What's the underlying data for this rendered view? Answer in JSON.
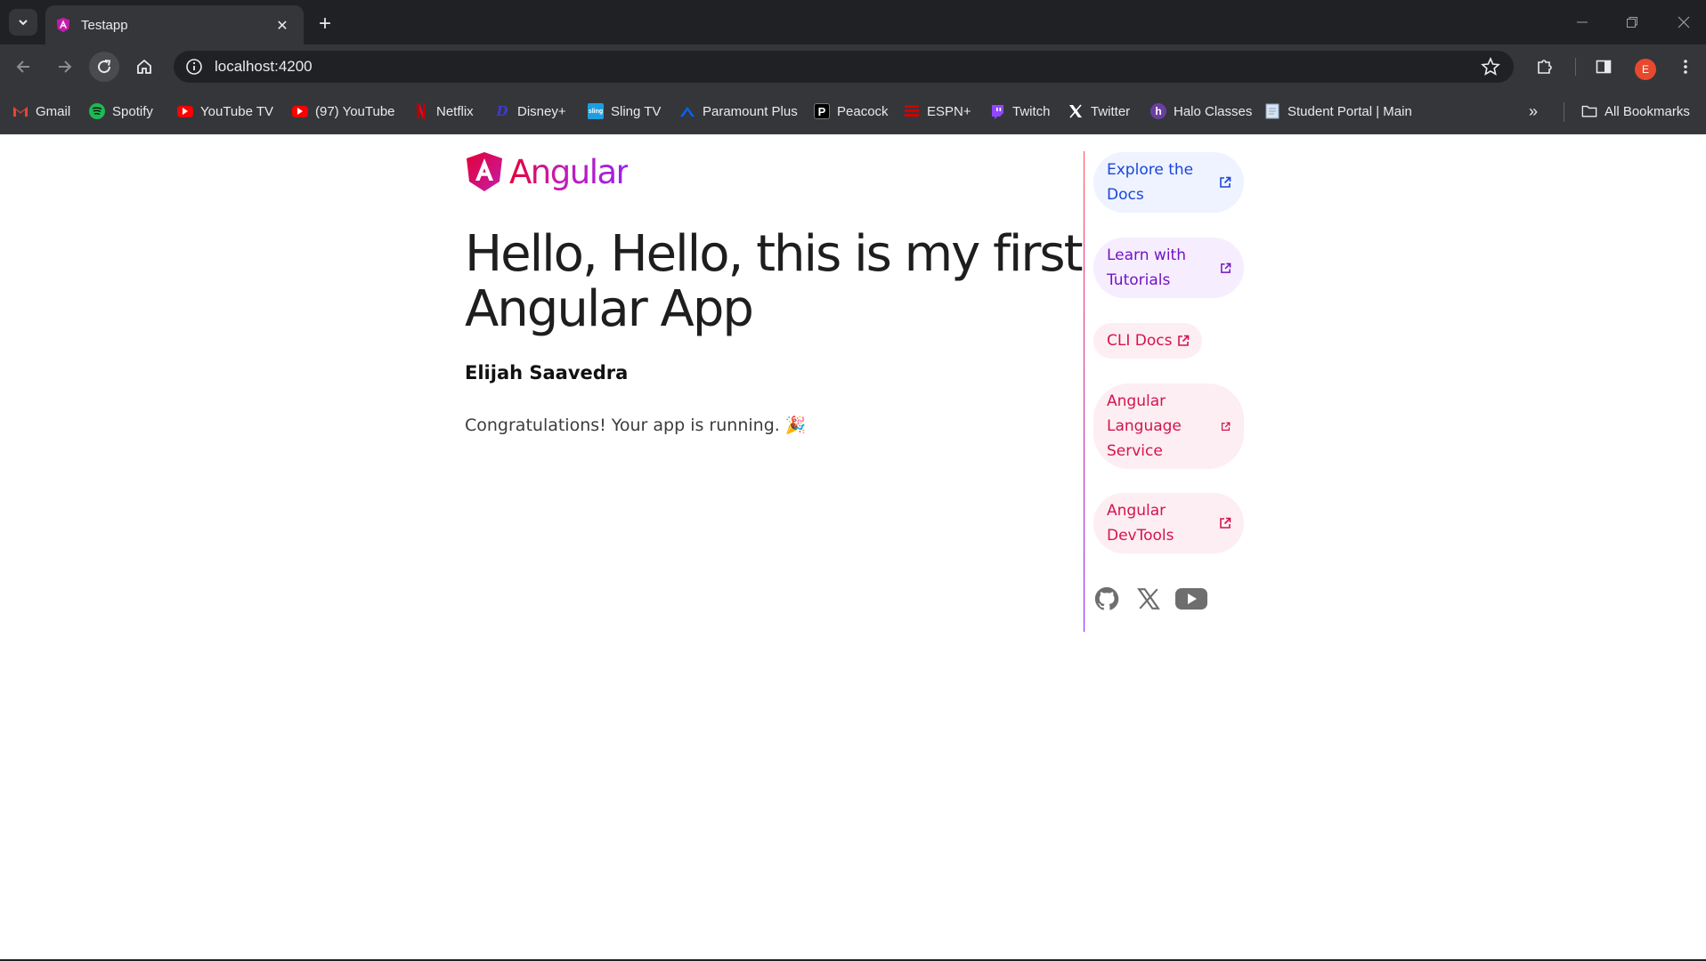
{
  "browser": {
    "tab_title": "Testapp",
    "url": "localhost:4200",
    "profile_initial": "E",
    "bookmarks": [
      {
        "label": "Gmail",
        "icon": "gmail-icon",
        "color": "#ea4335"
      },
      {
        "label": "Spotify",
        "icon": "spotify-icon",
        "color": "#1db954"
      },
      {
        "label": "YouTube TV",
        "icon": "youtube-tv-icon",
        "color": "#ff0000"
      },
      {
        "label": "(97) YouTube",
        "icon": "youtube-icon",
        "color": "#ff0000"
      },
      {
        "label": "Netflix",
        "icon": "netflix-icon",
        "color": "#e50914"
      },
      {
        "label": "Disney+",
        "icon": "disney-icon",
        "color": "#3d3bd1"
      },
      {
        "label": "Sling TV",
        "icon": "sling-icon",
        "color": "#1e9ee0"
      },
      {
        "label": "Paramount Plus",
        "icon": "paramount-icon",
        "color": "#0064ff"
      },
      {
        "label": "Peacock",
        "icon": "peacock-icon",
        "color": "#ffffff"
      },
      {
        "label": "ESPN+",
        "icon": "espn-icon",
        "color": "#d00000"
      },
      {
        "label": "Twitch",
        "icon": "twitch-icon",
        "color": "#9146ff"
      },
      {
        "label": "Twitter",
        "icon": "x-icon",
        "color": "#ffffff"
      },
      {
        "label": "Halo Classes",
        "icon": "halo-icon",
        "color": "#6b3fa0"
      },
      {
        "label": "Student Portal | Main",
        "icon": "page-icon",
        "color": "#d8e4f0"
      }
    ],
    "all_bookmarks_label": "All Bookmarks"
  },
  "app": {
    "logo_text": "Angular",
    "title": "Hello, Hello, this is my first Angular App",
    "author": "Elijah Saavedra",
    "congrats": "Congratulations! Your app is running. 🎉",
    "links": [
      {
        "label": "Explore the Docs",
        "style": "blue"
      },
      {
        "label": "Learn with Tutorials",
        "style": "purple"
      },
      {
        "label": "CLI Docs",
        "style": "pink"
      },
      {
        "label": "Angular Language Service",
        "style": "pink"
      },
      {
        "label": "Angular DevTools",
        "style": "pink"
      }
    ],
    "social": [
      "github-icon",
      "x-icon",
      "youtube-icon"
    ]
  }
}
